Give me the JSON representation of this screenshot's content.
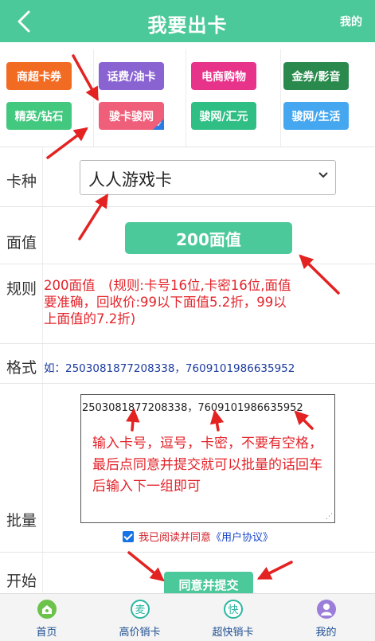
{
  "header": {
    "title": "我要出卡",
    "mine": "我的"
  },
  "categories": [
    {
      "label": "商超卡券",
      "color": "#f26b22"
    },
    {
      "label": "话费/油卡",
      "color": "#8a63d2"
    },
    {
      "label": "电商购物",
      "color": "#e8338b"
    },
    {
      "label": "金券/影音",
      "color": "#2a8a4e"
    },
    {
      "label": "精英/钻石",
      "color": "#42c87f"
    },
    {
      "label": "骏卡骏网",
      "color": "#ef5f7a",
      "selected": true
    },
    {
      "label": "骏网/汇元",
      "color": "#2fbf85"
    },
    {
      "label": "骏网/生活",
      "color": "#44a7f0"
    }
  ],
  "form": {
    "card_type_label": "卡种",
    "card_type_value": "人人游戏卡",
    "face_label": "面值",
    "face_value": "200面值",
    "rule_label": "规则",
    "rule_text": "200面值　(规则:卡号16位,卡密16位,面值要准确，回收价:99以下面值5.2折，99以上面值的7.2折)",
    "format_label": "格式",
    "format_text": "如：2503081877208338，7609101986635952",
    "batch_label": "批量",
    "batch_value": "2503081877208338，7609101986635952",
    "batch_hint": "输入卡号，逗号，卡密，不要有空格，最后点同意并提交就可以批量的话回车后输入下一组即可",
    "agree_text": "我已阅读并同意",
    "agree_link": "《用户协议》",
    "start_label": "开始",
    "submit_label": "同意并提交"
  },
  "tabs": [
    {
      "label": "首页",
      "icon": "home-icon",
      "color": "#6cc24a"
    },
    {
      "label": "高价销卡",
      "icon": "sell-icon",
      "color": "#2bb6a0"
    },
    {
      "label": "超快销卡",
      "icon": "fast-icon",
      "color": "#2bb6a0"
    },
    {
      "label": "我的",
      "icon": "user-icon",
      "color": "#9b7ed9"
    }
  ]
}
